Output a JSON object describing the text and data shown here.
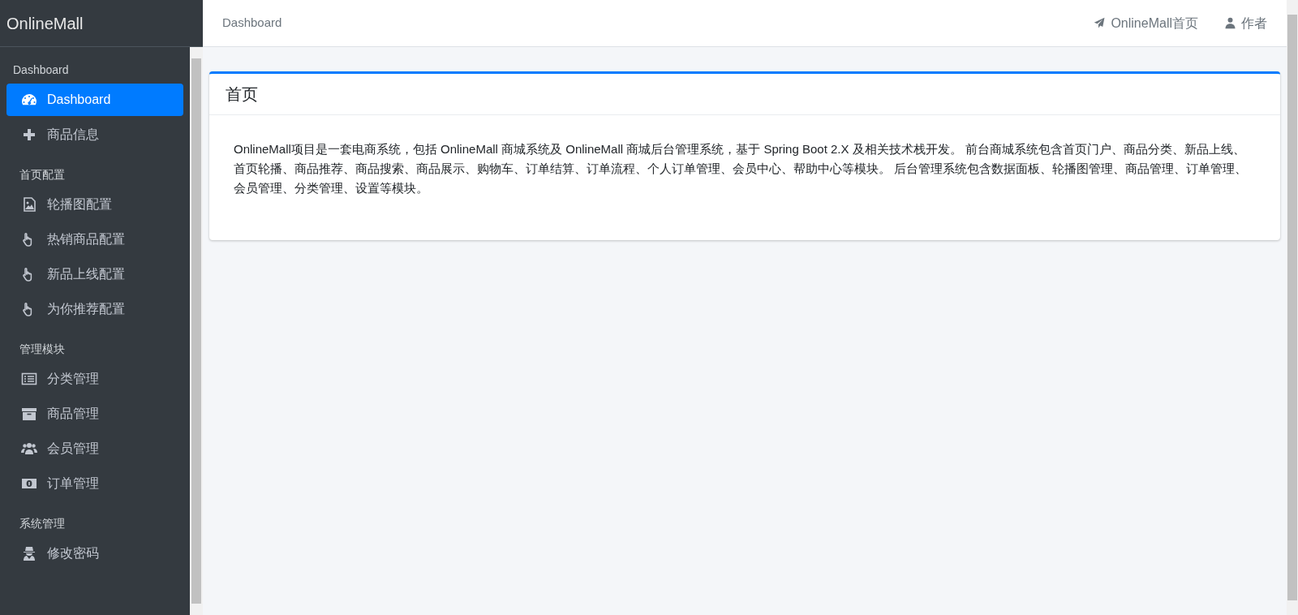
{
  "brand": "OnlineMall",
  "sidebar": {
    "sections": [
      {
        "header": "Dashboard",
        "items": [
          {
            "label": "Dashboard",
            "selected": true
          },
          {
            "label": "商品信息",
            "selected": false
          }
        ]
      },
      {
        "header": "首页配置",
        "items": [
          {
            "label": "轮播图配置",
            "selected": false
          },
          {
            "label": "热销商品配置",
            "selected": false
          },
          {
            "label": "新品上线配置",
            "selected": false
          },
          {
            "label": "为你推荐配置",
            "selected": false
          }
        ]
      },
      {
        "header": "管理模块",
        "items": [
          {
            "label": "分类管理",
            "selected": false
          },
          {
            "label": "商品管理",
            "selected": false
          },
          {
            "label": "会员管理",
            "selected": false
          },
          {
            "label": "订单管理",
            "selected": false
          }
        ]
      },
      {
        "header": "系统管理",
        "items": [
          {
            "label": "修改密码",
            "selected": false
          }
        ]
      }
    ]
  },
  "topbar": {
    "breadcrumb": "Dashboard",
    "links": [
      "OnlineMall首页",
      "作者"
    ]
  },
  "card": {
    "title": "首页",
    "body": "OnlineMall项目是一套电商系统，包括 OnlineMall 商城系统及 OnlineMall 商城后台管理系统，基于 Spring Boot 2.X 及相关技术栈开发。 前台商城系统包含首页门户、商品分类、新品上线、首页轮播、商品推荐、商品搜索、商品展示、购物车、订单结算、订单流程、个人订单管理、会员中心、帮助中心等模块。 后台管理系统包含数据面板、轮播图管理、商品管理、订单管理、会员管理、分类管理、设置等模块。"
  }
}
